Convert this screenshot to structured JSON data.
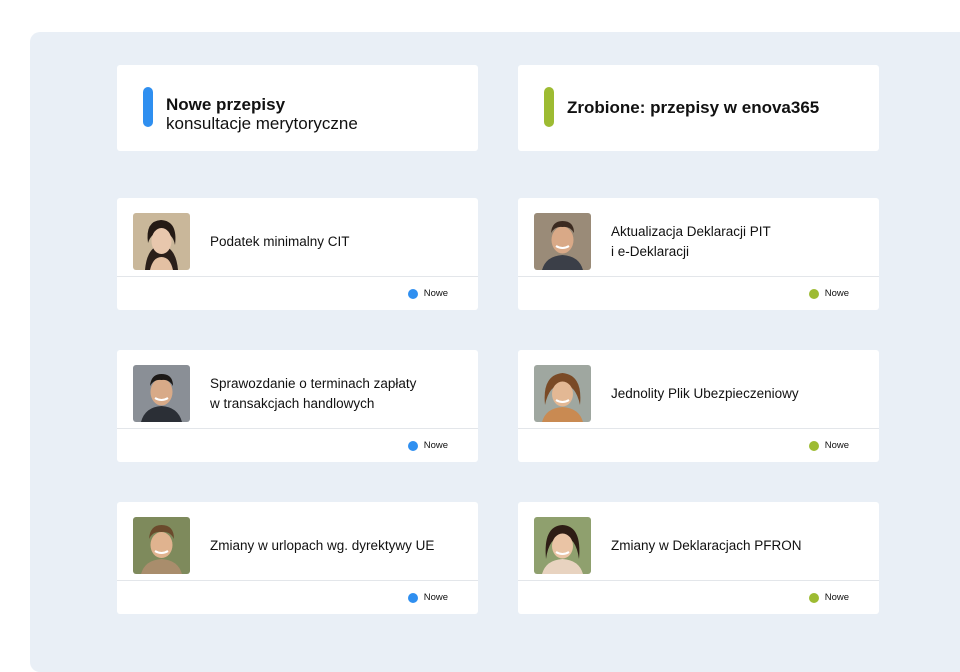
{
  "colors": {
    "blue": "#2f8ff0",
    "green": "#9dbb32",
    "background": "#e9eff6"
  },
  "left_column": {
    "header": {
      "line1": "Nowe przepisy",
      "line2": "konsultacje merytoryczne"
    },
    "items": [
      {
        "title_lines": [
          "Podatek minimalny CIT"
        ],
        "status": "Nowe",
        "avatar": "woman-avatar"
      },
      {
        "title_lines": [
          "Sprawozdanie o terminach zapłaty",
          "w transakcjach handlowych"
        ],
        "status": "Nowe",
        "avatar": "man-avatar"
      },
      {
        "title_lines": [
          "Zmiany w urlopach wg. dyrektywy UE"
        ],
        "status": "Nowe",
        "avatar": "man-avatar"
      }
    ]
  },
  "right_column": {
    "header": {
      "line1": "Zrobione:  przepisy w enova365"
    },
    "items": [
      {
        "title_lines": [
          "Aktualizacja Deklaracji PIT",
          "i e-Deklaracji"
        ],
        "status": "Nowe",
        "avatar": "man-avatar"
      },
      {
        "title_lines": [
          "Jednolity Plik Ubezpieczeniowy"
        ],
        "status": "Nowe",
        "avatar": "woman-avatar"
      },
      {
        "title_lines": [
          "Zmiany w Deklaracjach PFRON"
        ],
        "status": "Nowe",
        "avatar": "woman-avatar"
      }
    ]
  }
}
